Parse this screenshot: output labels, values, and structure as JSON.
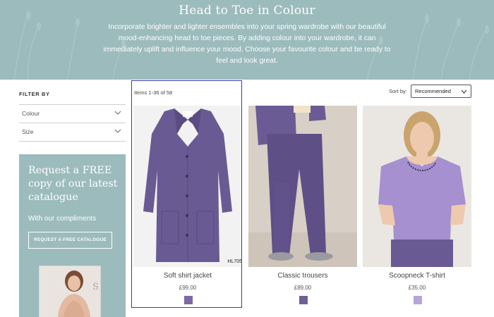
{
  "hero": {
    "title": "Head to Toe in Colour",
    "text": "Incorporate brighter and lighter ensembles into your spring wardrobe with our beautiful mood-enhancing head to toe pieces. By adding colour into your wardrobe, it can immediately uplift and influence your mood. Choose your favourite colour and be ready to feel and look great."
  },
  "filters": {
    "heading": "FILTER BY",
    "items": [
      {
        "label": "Colour",
        "icon": "chevron-down-icon"
      },
      {
        "label": "Size",
        "icon": "chevron-down-icon"
      }
    ]
  },
  "promo": {
    "title": "Request a FREE copy of our latest catalogue",
    "subtitle": "With our compliments",
    "button": "REQUEST A FREE CATALOGUE"
  },
  "listing": {
    "items_count": "Items 1-36 of 58",
    "sort_label": "Sort by:",
    "sort_value": "Recommended"
  },
  "products": [
    {
      "name": "Soft shirt jacket",
      "price": "£99.00",
      "sku": "HL705",
      "swatch_color": "#7a6aa3"
    },
    {
      "name": "Classic trousers",
      "price": "£89.00",
      "swatch_color": "#6f5f98"
    },
    {
      "name": "Scoopneck T-shirt",
      "price": "£35.00",
      "swatch_color": "#b8a4d6"
    }
  ],
  "colors": {
    "hero_bg": "#9cbbbd",
    "accent_frame": "#3a3aa8",
    "purple": "#6f5f98"
  }
}
